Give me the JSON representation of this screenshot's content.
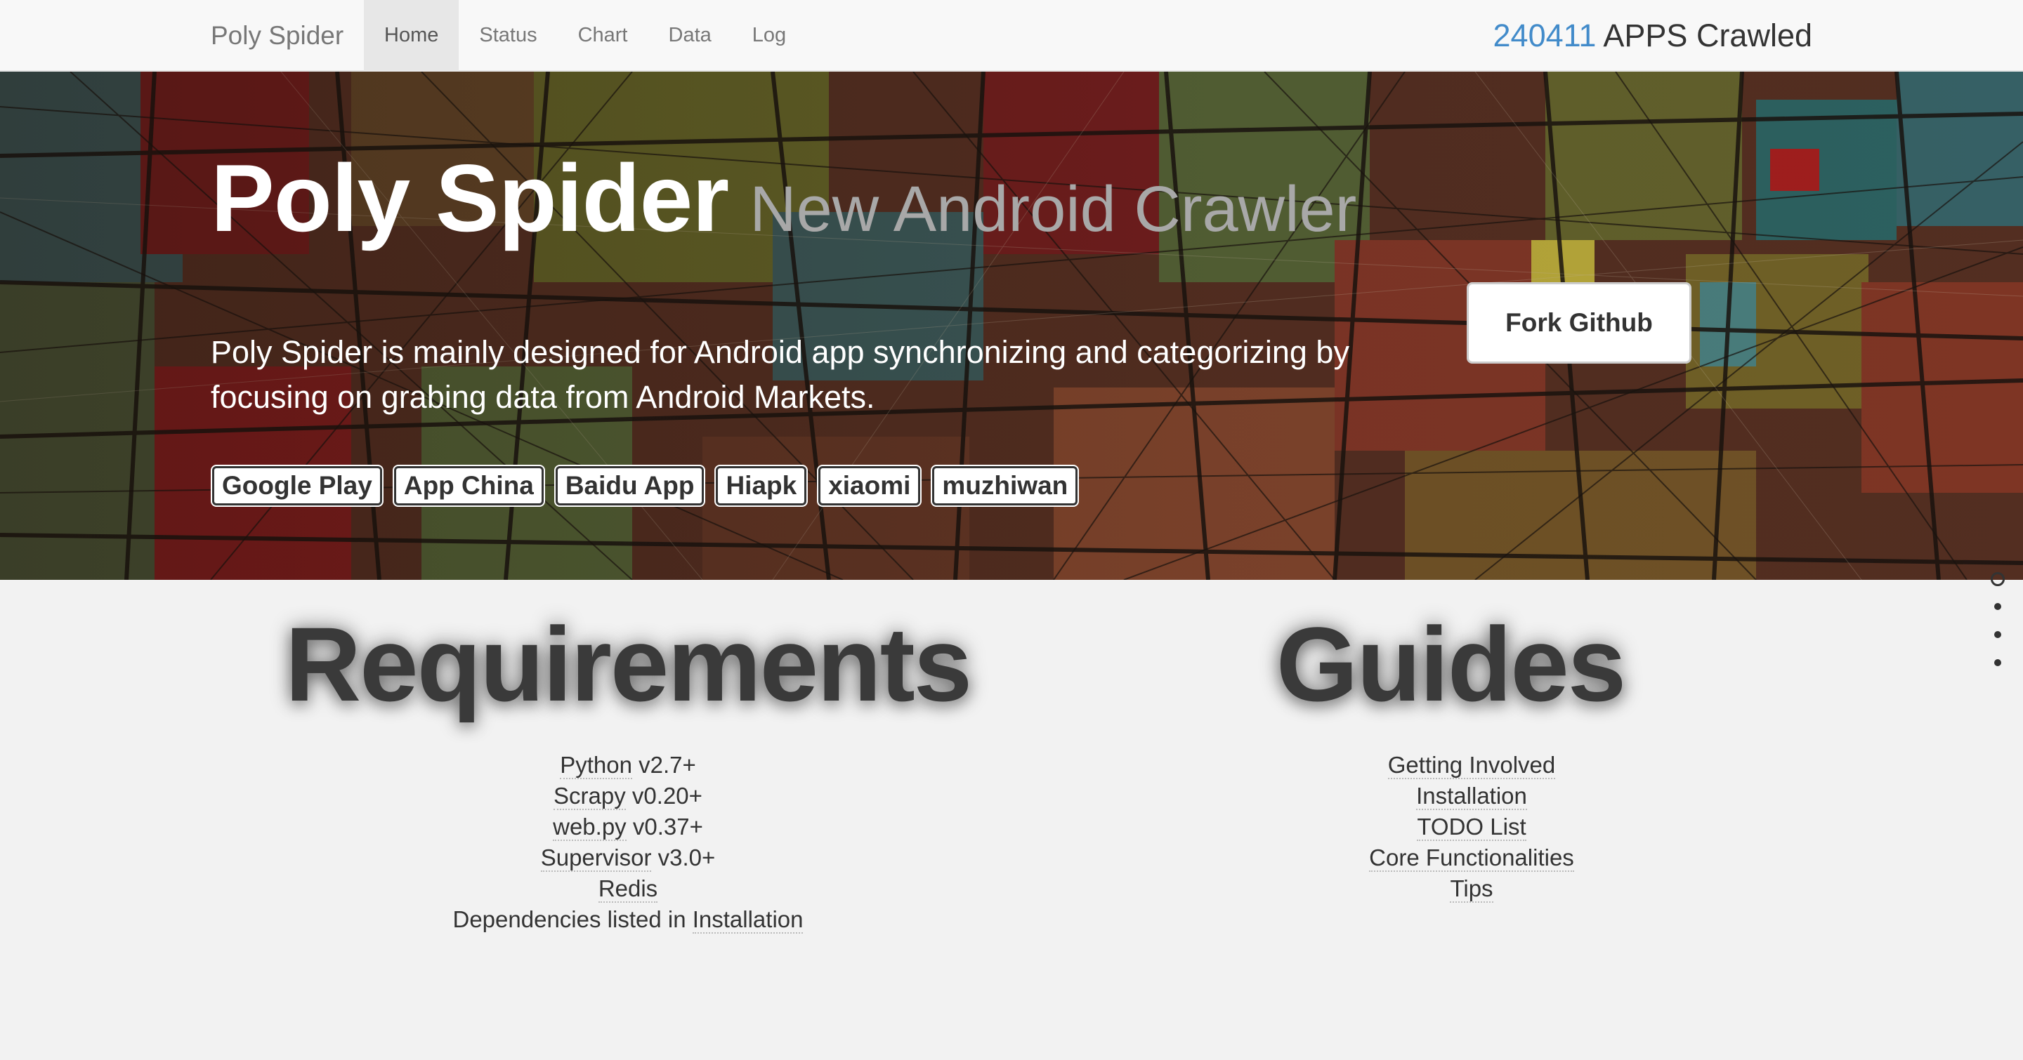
{
  "navbar": {
    "brand": "Poly Spider",
    "items": [
      {
        "label": "Home",
        "active": true
      },
      {
        "label": "Status",
        "active": false
      },
      {
        "label": "Chart",
        "active": false
      },
      {
        "label": "Data",
        "active": false
      },
      {
        "label": "Log",
        "active": false
      }
    ],
    "counter": {
      "value": "240411",
      "suffix": " APPS Crawled",
      "value_color": "#428bca"
    }
  },
  "hero": {
    "title": "Poly Spider",
    "subtitle": "New Android Crawler",
    "description": "Poly Spider is mainly designed for Android app synchronizing and categorizing by focusing on grabing data from Android Markets.",
    "markets": [
      "Google Play",
      "App China",
      "Baidu App",
      "Hiapk",
      "xiaomi",
      "muzhiwan"
    ],
    "fork_button": "Fork Github"
  },
  "requirements": {
    "heading": "Requirements",
    "items": [
      {
        "link": "Python",
        "rest": " v2.7+"
      },
      {
        "link": "Scrapy",
        "rest": " v0.20+"
      },
      {
        "link": "web.py",
        "rest": " v0.37+"
      },
      {
        "link": "Supervisor",
        "rest": " v3.0+"
      },
      {
        "link": "Redis",
        "rest": ""
      },
      {
        "pre": "Dependencies listed in ",
        "link": "Installation"
      }
    ]
  },
  "guides": {
    "heading": "Guides",
    "items": [
      "Getting Involved",
      "Installation",
      "TODO List",
      "Core Functionalities",
      "Tips"
    ]
  },
  "side_nav": {
    "count": 4,
    "active_index": 0
  },
  "colors": {
    "accent": "#428bca",
    "nav_bg": "#f8f8f8",
    "page_bg": "#f2f2f2"
  }
}
